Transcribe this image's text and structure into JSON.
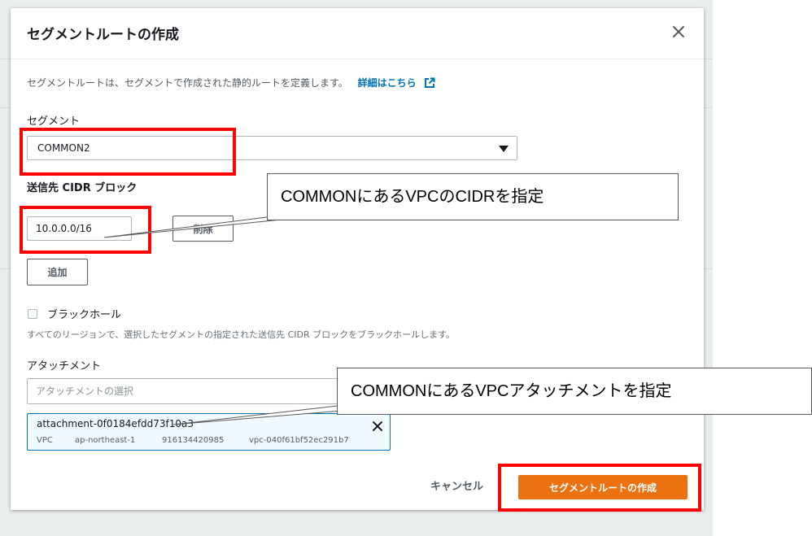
{
  "dialog": {
    "title": "セグメントルートの作成",
    "description": "セグメントルートは、セグメントで作成された静的ルートを定義します。",
    "learn_more": "詳細はこちら"
  },
  "segment": {
    "label": "セグメント",
    "value": "COMMON2"
  },
  "cidr": {
    "label": "送信先 CIDR ブロック",
    "value": "10.0.0.0/16",
    "remove_label": "削除",
    "add_label": "追加"
  },
  "blackhole": {
    "label": "ブラックホール",
    "hint": "すべてのリージョンで、選択したセグメントの指定された送信先 CIDR ブロックをブラックホールします。"
  },
  "attachment": {
    "label": "アタッチメント",
    "placeholder": "アタッチメントの選択",
    "selected": {
      "id": "attachment-0f0184efdd73f10a3",
      "type": "VPC",
      "region": "ap-northeast-1",
      "account": "916134420985",
      "vpc": "vpc-040f61bf52ec291b7"
    }
  },
  "footer": {
    "cancel_label": "キャンセル",
    "create_label": "セグメントルートの作成"
  },
  "annotations": {
    "cidr_callout": "COMMONにあるVPCのCIDRを指定",
    "attachment_callout": "COMMONにあるVPCアタッチメントを指定"
  },
  "colors": {
    "primary": "#ec7211",
    "link": "#0073bb",
    "highlight": "#ff0000"
  }
}
